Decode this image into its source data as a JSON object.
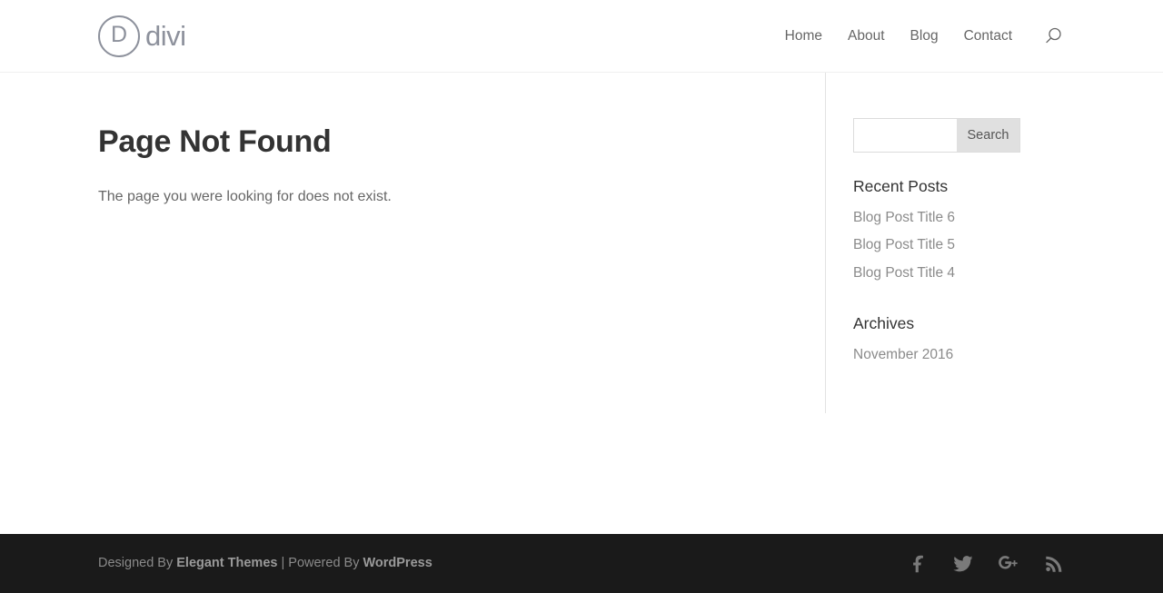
{
  "site": {
    "logo_letter": "D",
    "logo_word": "divi"
  },
  "header": {
    "nav": [
      {
        "label": "Home"
      },
      {
        "label": "About"
      },
      {
        "label": "Blog"
      },
      {
        "label": "Contact"
      }
    ],
    "search_toggle_name": "search-icon"
  },
  "main": {
    "title": "Page Not Found",
    "body": "The page you were looking for does not exist."
  },
  "sidebar": {
    "search": {
      "value": "",
      "placeholder": "",
      "button_label": "Search"
    },
    "widgets": [
      {
        "title": "Recent Posts",
        "items": [
          {
            "label": "Blog Post Title 6"
          },
          {
            "label": "Blog Post Title 5"
          },
          {
            "label": "Blog Post Title 4"
          }
        ]
      },
      {
        "title": "Archives",
        "items": [
          {
            "label": "November 2016"
          }
        ]
      }
    ]
  },
  "footer": {
    "credits": {
      "prefix": "Designed By ",
      "designer": "Elegant Themes",
      "separator": " | Powered By ",
      "platform": "WordPress"
    },
    "social": [
      {
        "name": "facebook-icon",
        "label": "Facebook"
      },
      {
        "name": "twitter-icon",
        "label": "Twitter"
      },
      {
        "name": "google-plus-icon",
        "label": "Google Plus"
      },
      {
        "name": "rss-icon",
        "label": "RSS"
      }
    ]
  },
  "colors": {
    "accent": "#2ea3f2",
    "logo_gray": "#8d919c",
    "text_gray": "#666666",
    "heading_dark": "#333333",
    "footer_bg": "#1a1a1a",
    "button_gray": "#e0e0e0"
  }
}
